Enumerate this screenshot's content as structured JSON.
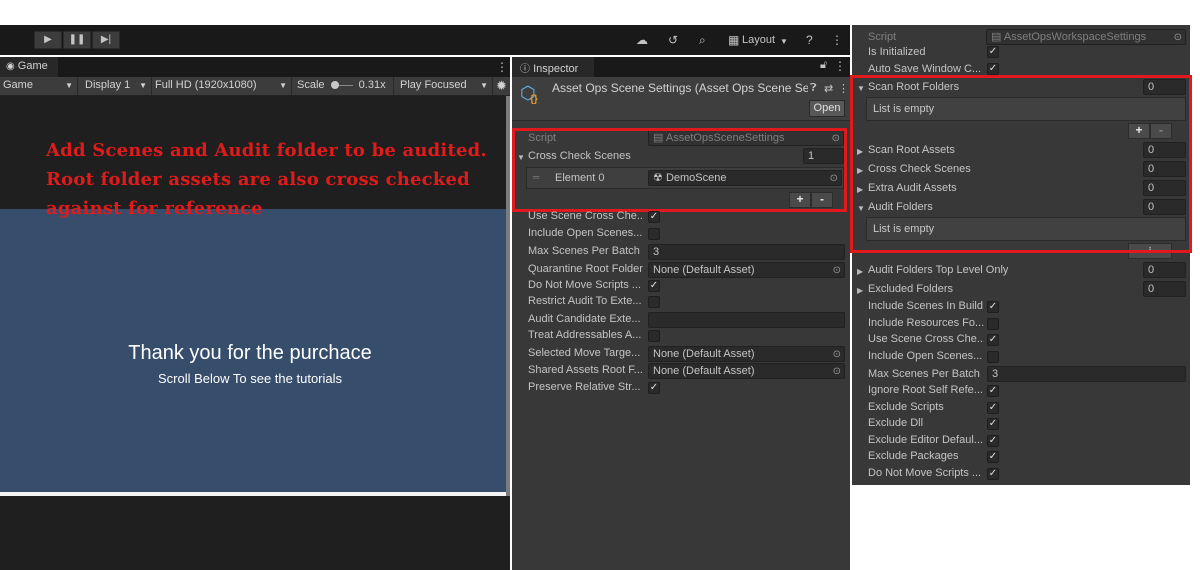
{
  "toolbar": {
    "layout_label": "Layout"
  },
  "game": {
    "tab_label": "Game",
    "view_select": "Game",
    "display_select": "Display 1",
    "resolution_select": "Full HD (1920x1080)",
    "scale_label": "Scale",
    "scale_value": "0.31x",
    "play_mode": "Play Focused",
    "title": "Thank you for the purchace",
    "subtitle": "Scroll Below To see the tutorials",
    "annotation": "Add Scenes and Audit folder to be audited. Root folder assets are also cross checked against for reference"
  },
  "inspector": {
    "tab_label": "Inspector",
    "asset_title": "Asset Ops Scene Settings (Asset Ops Scene Se",
    "open_button": "Open",
    "script_label": "Script",
    "script_value": "AssetOpsSceneSettings",
    "cross_check_label": "Cross Check Scenes",
    "cross_check_count": "1",
    "element_label": "Element 0",
    "element_value": "DemoScene",
    "plus": "+",
    "minus": "-",
    "rows": [
      {
        "label": "Use Scene Cross Che...",
        "type": "check",
        "checked": "✓"
      },
      {
        "label": "Include Open Scenes...",
        "type": "check",
        "checked": ""
      },
      {
        "label": "Max Scenes Per Batch",
        "type": "field",
        "value": "3"
      },
      {
        "label": "Quarantine Root Folder",
        "type": "object",
        "value": "None (Default Asset)"
      },
      {
        "label": "Do Not Move Scripts ...",
        "type": "check",
        "checked": "✓"
      },
      {
        "label": "Restrict Audit To Exte...",
        "type": "check",
        "checked": ""
      },
      {
        "label": "Audit Candidate Exte...",
        "type": "field",
        "value": ""
      },
      {
        "label": "Treat Addressables A...",
        "type": "check",
        "checked": ""
      },
      {
        "label": "Selected Move Targe...",
        "type": "object",
        "value": "None (Default Asset)"
      },
      {
        "label": "Shared Assets Root F...",
        "type": "object",
        "value": "None (Default Asset)"
      },
      {
        "label": "Preserve Relative Str...",
        "type": "check",
        "checked": "✓"
      }
    ]
  },
  "workspace": {
    "script_label": "Script",
    "script_value": "AssetOpsWorkspaceSettings",
    "is_initialized_label": "Is Initialized",
    "auto_save_label": "Auto Save Window C...",
    "scan_root_folders_label": "Scan Root Folders",
    "scan_root_folders_count": "0",
    "list_empty_1": "List is empty",
    "scan_root_assets_label": "Scan Root Assets",
    "scan_root_assets_count": "0",
    "cross_check_scenes_label": "Cross Check Scenes",
    "cross_check_scenes_count": "0",
    "extra_audit_label": "Extra Audit Assets",
    "extra_audit_count": "0",
    "audit_folders_label": "Audit Folders",
    "audit_folders_count": "0",
    "list_empty_2": "List is empty",
    "audit_top_level_label": "Audit Folders Top Level Only",
    "audit_top_level_count": "0",
    "excluded_folders_label": "Excluded Folders",
    "excluded_folders_count": "0",
    "checks": [
      {
        "label": "Include Scenes In Build",
        "checked": "✓"
      },
      {
        "label": "Include Resources Fo...",
        "checked": ""
      },
      {
        "label": "Use Scene Cross Che...",
        "checked": "✓"
      },
      {
        "label": "Include Open Scenes...",
        "checked": ""
      }
    ],
    "max_scenes_label": "Max Scenes Per Batch",
    "max_scenes_value": "3",
    "checks2": [
      {
        "label": "Ignore Root Self Refe...",
        "checked": "✓"
      },
      {
        "label": "Exclude Scripts",
        "checked": "✓"
      },
      {
        "label": "Exclude Dll",
        "checked": "✓"
      },
      {
        "label": "Exclude Editor Defaul...",
        "checked": "✓"
      },
      {
        "label": "Exclude Packages",
        "checked": "✓"
      },
      {
        "label": "Do Not Move Scripts ...",
        "checked": "✓"
      }
    ]
  }
}
